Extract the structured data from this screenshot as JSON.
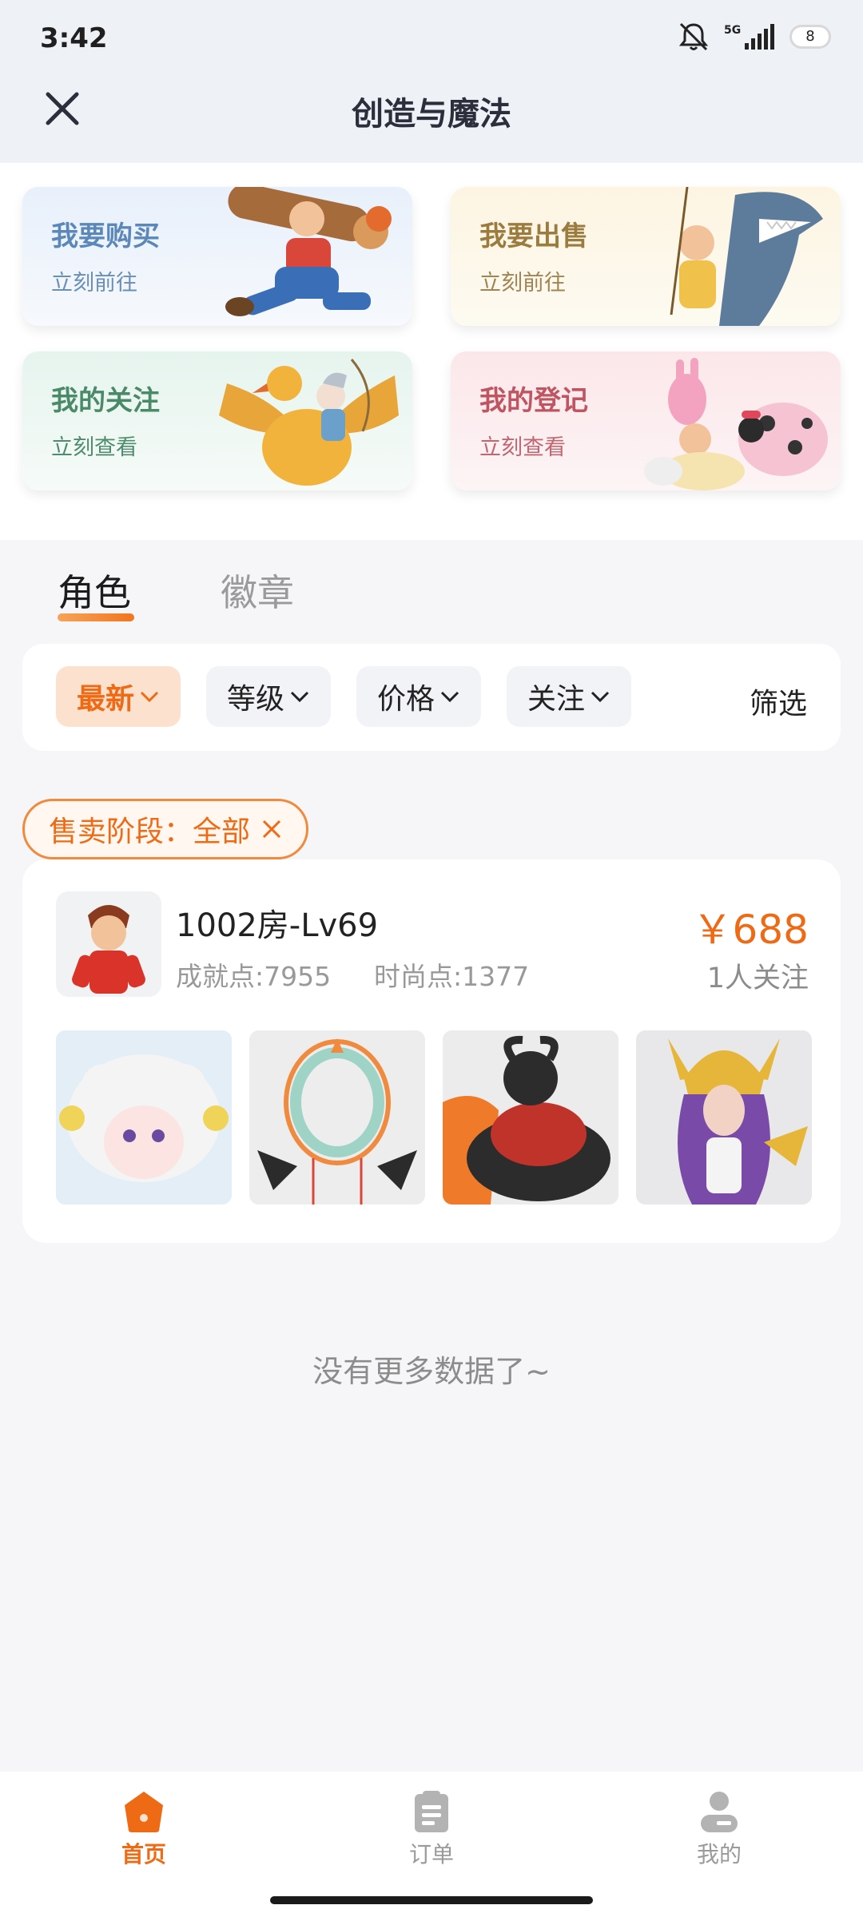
{
  "status_bar": {
    "time": "3:42",
    "network": "5G",
    "battery": "8"
  },
  "header": {
    "title": "创造与魔法"
  },
  "quick_actions": [
    {
      "title": "我要购买",
      "subtitle": "立刻前往"
    },
    {
      "title": "我要出售",
      "subtitle": "立刻前往"
    },
    {
      "title": "我的关注",
      "subtitle": "立刻查看"
    },
    {
      "title": "我的登记",
      "subtitle": "立刻查看"
    }
  ],
  "tabs": [
    {
      "label": "角色",
      "active": true
    },
    {
      "label": "徽章",
      "active": false
    }
  ],
  "filters": {
    "sort_chips": [
      "最新",
      "等级",
      "价格",
      "关注"
    ],
    "active": "最新",
    "screen_label": "筛选"
  },
  "stage_filter": {
    "label": "售卖阶段：全部"
  },
  "listing": {
    "title": "1002房-Lv69",
    "achievement": "成就点:7955",
    "fashion": "时尚点:1377",
    "price": "￥688",
    "followers": "1人关注"
  },
  "empty_text": "没有更多数据了~",
  "bottom_nav": [
    {
      "label": "首页",
      "active": true
    },
    {
      "label": "订单",
      "active": false
    },
    {
      "label": "我的",
      "active": false
    }
  ],
  "colors": {
    "accent": "#ef6a15",
    "accent_light": "#fde1cf"
  }
}
